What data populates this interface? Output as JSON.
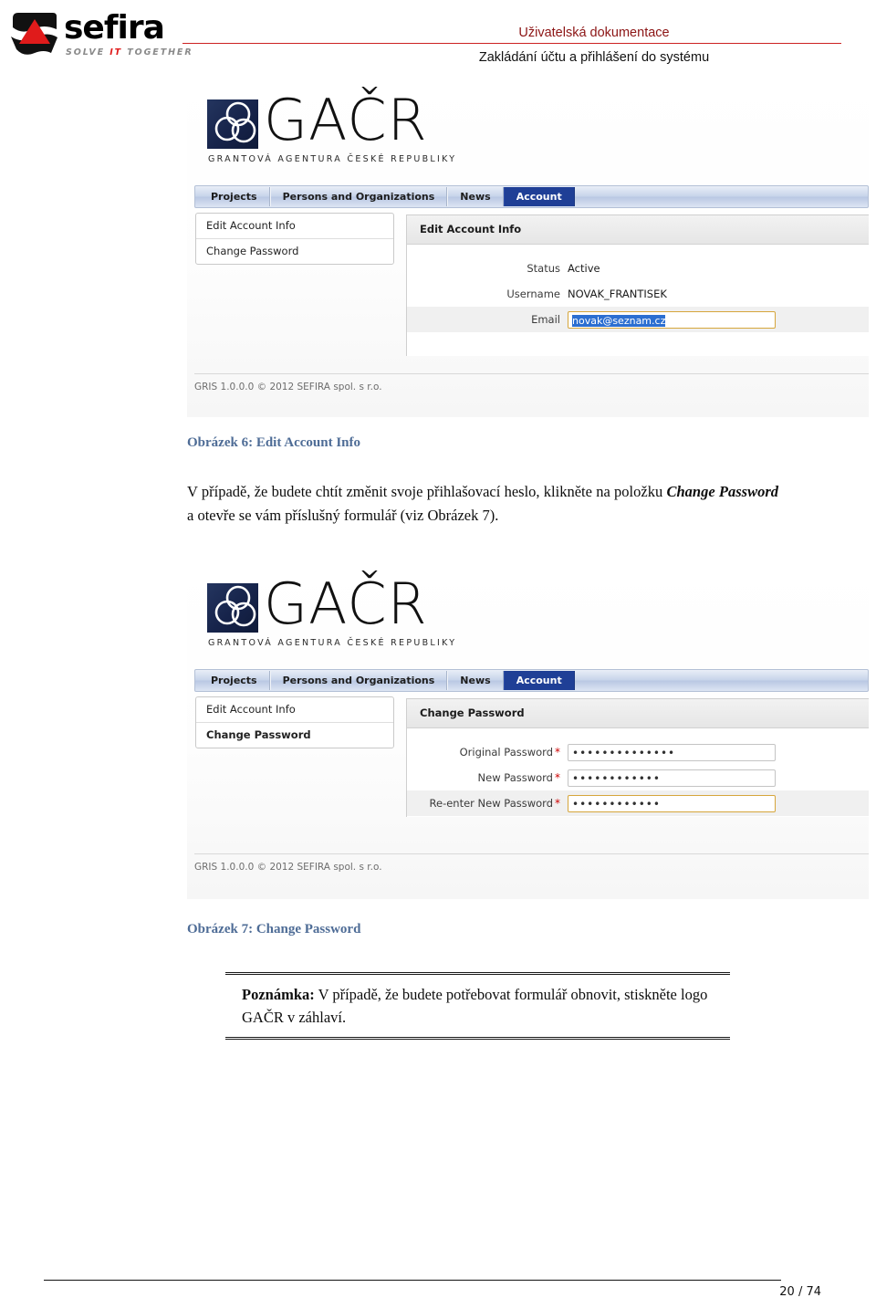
{
  "header": {
    "logo_word": "sefira",
    "logo_tagline_before": "SOLVE ",
    "logo_tagline_it": "IT",
    "logo_tagline_after": " TOGETHER",
    "doc_title": "Uživatelská dokumentace",
    "doc_subtitle": "Zakládání účtu a přihlášení do systému",
    "rule_color": "#cc2222",
    "title_color": "#8c1515"
  },
  "app": {
    "brand_word": "GAČR",
    "brand_subtitle": "GRANTOVÁ AGENTURA ČESKÉ REPUBLIKY",
    "brand_mark_color": "#1b2a52",
    "accent_active_tab": "#1f3f96",
    "focus_border_color": "#d6a63c",
    "selection_color": "#2c6fd1",
    "required_color": "#cc0000",
    "tabs": [
      {
        "label": "Projects",
        "active": false
      },
      {
        "label": "Persons and Organizations",
        "active": false
      },
      {
        "label": "News",
        "active": false
      },
      {
        "label": "Account",
        "active": true
      }
    ],
    "sidebar": [
      {
        "label": "Edit Account Info"
      },
      {
        "label": "Change Password"
      }
    ],
    "footer": "GRIS 1.0.0.0 © 2012 SEFIRA spol. s r.o."
  },
  "screenshot1": {
    "panel_title": "Edit Account Info",
    "fields": [
      {
        "label": "Status",
        "value": "Active"
      },
      {
        "label": "Username",
        "value": "NOVAK_FRANTISEK"
      },
      {
        "label": "Email",
        "value": "novak@seznam.cz"
      }
    ]
  },
  "screenshot2": {
    "panel_title": "Change Password",
    "fields": [
      {
        "label": "Original Password",
        "required": "*",
        "value": "••••••••••••••"
      },
      {
        "label": "New Password",
        "required": "*",
        "value": "••••••••••••"
      },
      {
        "label": "Re-enter New Password",
        "required": "*",
        "value": "••••••••••••"
      }
    ]
  },
  "captions": {
    "figure6": "Obrázek 6: Edit Account Info",
    "figure7": "Obrázek 7: Change Password"
  },
  "body": {
    "para1_part1": "V případě, že budete chtít změnit svoje přihlašovací heslo, klikněte na položku ",
    "para1_emph": "Change Password",
    "para1_part2": " a otevře se vám příslušný formulář (viz Obrázek 7)."
  },
  "note": {
    "label": "Poznámka:",
    "text": " V případě, že budete potřebovat formulář obnovit, stiskněte logo GAČR v záhlaví."
  },
  "footer": {
    "page_number": "20 / 74"
  }
}
